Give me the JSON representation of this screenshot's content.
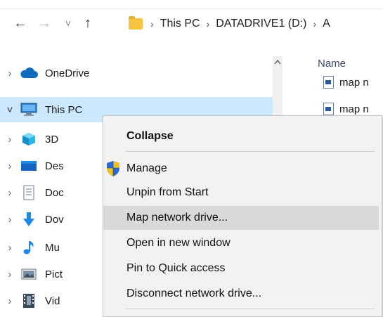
{
  "navigation": {
    "back_icon": "←",
    "forward_icon": "→",
    "recent_icon": "˅",
    "up_icon": "↑"
  },
  "breadcrumb": {
    "sep": "›",
    "items": [
      "This PC",
      "DATADRIVE1 (D:)",
      "A"
    ]
  },
  "tree": {
    "items": [
      {
        "label": "OneDrive",
        "icon": "cloud-icon",
        "expanded": false
      },
      {
        "label": "This PC",
        "icon": "computer-icon",
        "expanded": true,
        "selected": true
      },
      {
        "label": "3D",
        "icon": "3d-objects-icon"
      },
      {
        "label": "Des",
        "icon": "desktop-icon"
      },
      {
        "label": "Doc",
        "icon": "documents-icon"
      },
      {
        "label": "Dov",
        "icon": "downloads-icon"
      },
      {
        "label": "Mu",
        "icon": "music-icon"
      },
      {
        "label": "Pict",
        "icon": "pictures-icon"
      },
      {
        "label": "Vid",
        "icon": "videos-icon"
      }
    ],
    "collapsed_chevron": "›",
    "expanded_chevron": "˅"
  },
  "files": {
    "column_name": "Name",
    "rows": [
      "map n",
      "map n"
    ]
  },
  "context_menu": {
    "items": [
      {
        "label": "Collapse",
        "bold": true
      },
      {
        "label": "Manage",
        "icon": "uac-shield-icon"
      },
      {
        "label": "Unpin from Start"
      },
      {
        "label": "Map network drive...",
        "hover": true
      },
      {
        "label": "Open in new window"
      },
      {
        "label": "Pin to Quick access"
      },
      {
        "label": "Disconnect network drive..."
      }
    ]
  },
  "colors": {
    "selection": "#cce8ff",
    "menu_bg": "#f2f2f2",
    "menu_hover": "#d9d9d9"
  }
}
